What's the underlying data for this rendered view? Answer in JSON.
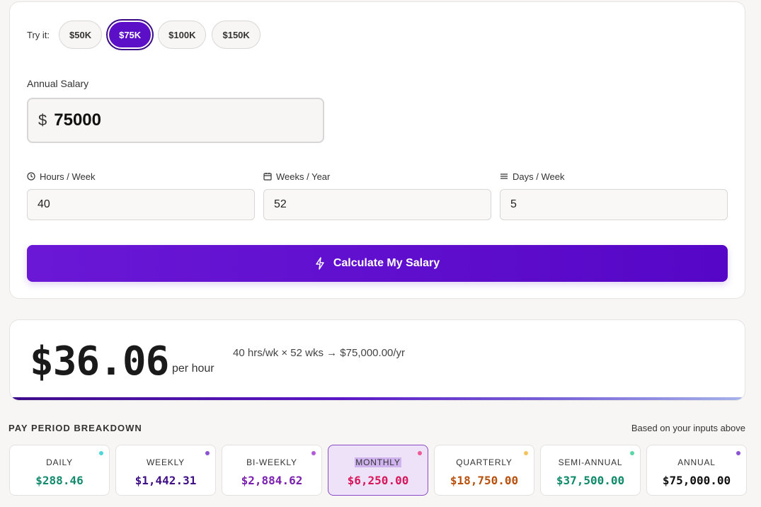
{
  "presets": {
    "label": "Try it:",
    "items": [
      "$50K",
      "$75K",
      "$100K",
      "$150K"
    ],
    "active_index": 1
  },
  "salary": {
    "label": "Annual Salary",
    "currency": "$",
    "value": "75000"
  },
  "fields": [
    {
      "label": "Hours / Week",
      "value": "40",
      "icon": "clock-icon"
    },
    {
      "label": "Weeks / Year",
      "value": "52",
      "icon": "calendar-icon"
    },
    {
      "label": "Days / Week",
      "value": "5",
      "icon": "menu-icon"
    }
  ],
  "calculate": {
    "label": "Calculate My Salary",
    "icon": "lightning-icon"
  },
  "result": {
    "rate": "$36.06",
    "unit": "per hour",
    "formula": "40 hrs/wk × 52 wks → $75,000.00/yr"
  },
  "breakdown": {
    "title": "PAY PERIOD BREAKDOWN",
    "note": "Based on your inputs above",
    "active_index": 3,
    "periods": [
      {
        "label": "DAILY",
        "value": "$288.46",
        "color": "#138a6e",
        "dot": "#4fd6d8"
      },
      {
        "label": "WEEKLY",
        "value": "$1,442.31",
        "color": "#3f0f86",
        "dot": "#8b52d4"
      },
      {
        "label": "BI-WEEKLY",
        "value": "$2,884.62",
        "color": "#7a1fb0",
        "dot": "#b45ad8"
      },
      {
        "label": "MONTHLY",
        "value": "$6,250.00",
        "color": "#d8165a",
        "dot": "#ef5a96"
      },
      {
        "label": "QUARTERLY",
        "value": "$18,750.00",
        "color": "#b8500e",
        "dot": "#f2c45a"
      },
      {
        "label": "SEMI-ANNUAL",
        "value": "$37,500.00",
        "color": "#0f8a6a",
        "dot": "#5ad6a8"
      },
      {
        "label": "ANNUAL",
        "value": "$75,000.00",
        "color": "#111111",
        "dot": "#8b52d4"
      }
    ]
  },
  "colors": {
    "accent": "#5b10c8",
    "background": "#f7f6f5"
  }
}
